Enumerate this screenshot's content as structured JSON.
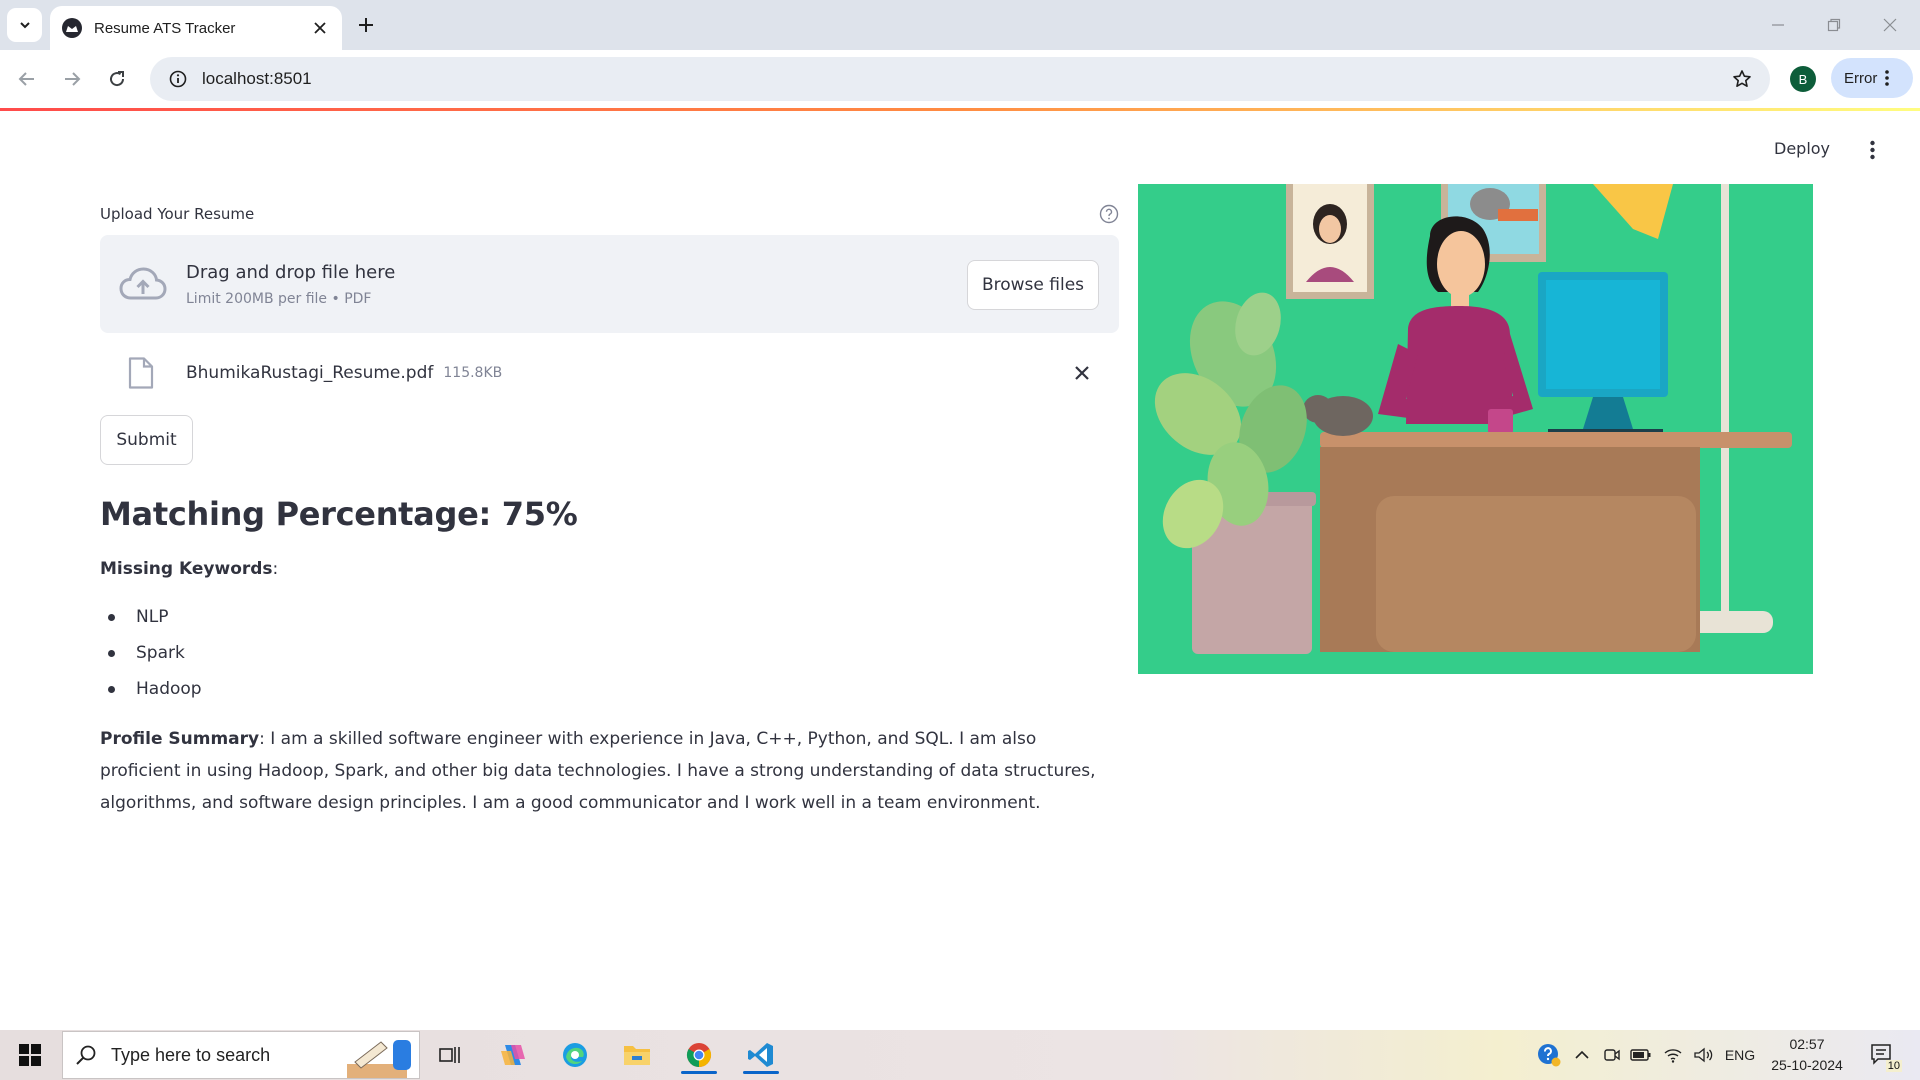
{
  "browser": {
    "tab_title": "Resume ATS Tracker",
    "url": "localhost:8501",
    "profile_initial": "B",
    "error_label": "Error"
  },
  "app": {
    "deploy_label": "Deploy",
    "uploader": {
      "label": "Upload Your Resume",
      "dropzone_title": "Drag and drop file here",
      "dropzone_limit": "Limit 200MB per file • PDF",
      "browse_label": "Browse files"
    },
    "file": {
      "name": "BhumikaRustagi_Resume.pdf",
      "size": "115.8KB"
    },
    "submit_label": "Submit",
    "match_heading": "Matching Percentage: 75%",
    "missing_keywords_label": "Missing Keywords",
    "missing_keywords_suffix": ":",
    "missing_keywords": [
      "NLP",
      "Spark",
      "Hadoop"
    ],
    "profile_summary_label": "Profile Summary",
    "profile_summary_text": ": I am a skilled software engineer with experience in Java, C++, Python, and SQL. I am also proficient in using Hadoop, Spark, and other big data technologies. I have a strong understanding of data structures, algorithms, and software design principles. I am a good communicator and I work well in a team environment."
  },
  "taskbar": {
    "search_placeholder": "Type here to search",
    "language": "ENG",
    "time": "02:57",
    "date": "25-10-2024",
    "notification_count": "10"
  },
  "colors": {
    "accent_gradient_start": "#ff4b4b",
    "accent_gradient_end": "#fffd80",
    "illustration_bg": "#34cd8a",
    "text": "#31333f"
  }
}
